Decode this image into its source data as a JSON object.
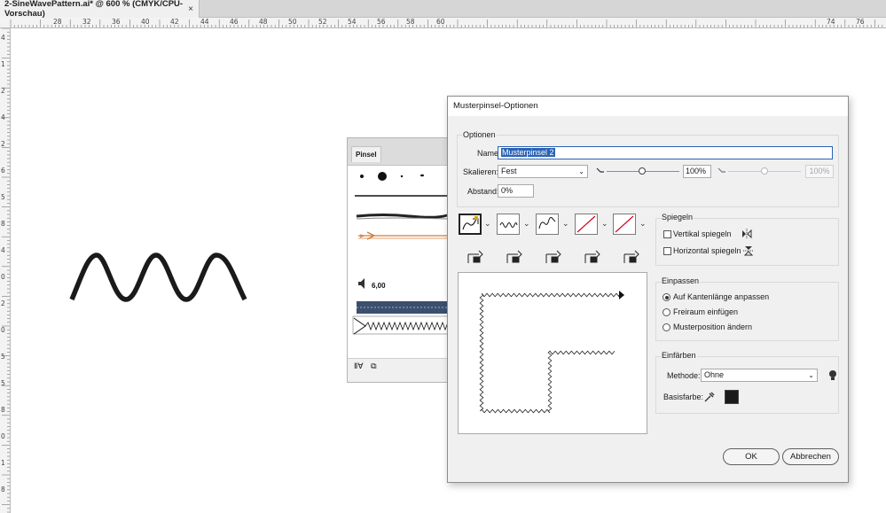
{
  "document_tab": {
    "title": "2-SineWavePattern.ai* @ 600 % (CMYK/CPU-Vorschau)",
    "close_glyph": "×"
  },
  "ruler_top_labels": [
    "28",
    "32",
    "36",
    "40",
    "42",
    "44",
    "46",
    "48",
    "50",
    "52",
    "54",
    "56",
    "58",
    "60",
    "74",
    "76"
  ],
  "ruler_left_labels": [
    "4",
    "1",
    "2",
    "4",
    "2",
    "6",
    "5",
    "8",
    "4",
    "0",
    "2",
    "0",
    "5",
    "5",
    "8",
    "0",
    "1",
    "8"
  ],
  "brushes_panel": {
    "tab_label": "Pinsel",
    "size_value": "6,00",
    "footer_icons": [
      "library-icon",
      "brush-options-icon"
    ]
  },
  "dialog": {
    "title": "Musterpinsel-Optionen",
    "options": {
      "group_title": "Optionen",
      "name_label": "Name:",
      "name_value": "Musterpinsel 2",
      "scale_label": "Skalieren:",
      "scale_mode": "Fest",
      "scale_value": "100%",
      "scale_value_disabled": "100%",
      "spacing_label": "Abstand:",
      "spacing_value": "0%"
    },
    "tiles": [
      "side-tile",
      "outer-corner-tile",
      "inner-corner-tile",
      "start-tile",
      "end-tile"
    ],
    "mirror": {
      "group_title": "Spiegeln",
      "vertical_label": "Vertikal spiegeln",
      "horizontal_label": "Horizontal spiegeln",
      "vertical_checked": false,
      "horizontal_checked": false
    },
    "fit": {
      "group_title": "Einpassen",
      "options": [
        "Auf Kantenlänge anpassen",
        "Freiraum einfügen",
        "Musterposition ändern"
      ],
      "selected_index": 0
    },
    "colorize": {
      "group_title": "Einfärben",
      "method_label": "Methode:",
      "method_value": "Ohne",
      "key_color_label": "Basisfarbe:",
      "key_color": "#1a1a1a"
    },
    "ok_label": "OK",
    "cancel_label": "Abbrechen"
  },
  "colors": {
    "accent": "#2a62b5",
    "stroke": "#1a1a1a"
  }
}
